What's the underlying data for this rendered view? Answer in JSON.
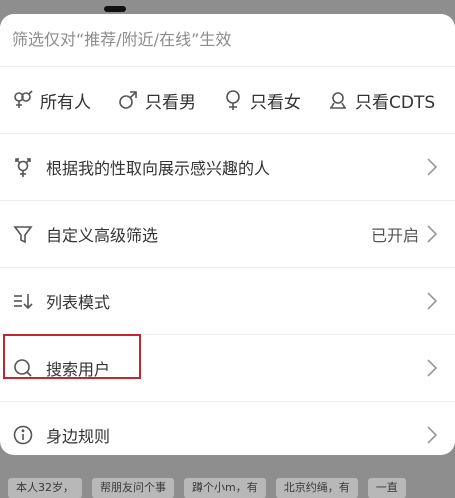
{
  "hint": "筛选仅对“推荐/附近/在线”生效",
  "gender_options": [
    {
      "icon": "all-genders-icon",
      "label": "所有人"
    },
    {
      "icon": "male-icon",
      "label": "只看男"
    },
    {
      "icon": "female-icon",
      "label": "只看女"
    },
    {
      "icon": "cdts-icon",
      "label": "只看CDTS"
    }
  ],
  "rows": [
    {
      "icon": "transgender-icon",
      "label": "根据我的性取向展示感兴趣的人",
      "status": ""
    },
    {
      "icon": "filter-icon",
      "label": "自定义高级筛选",
      "status": "已开启"
    },
    {
      "icon": "list-sort-icon",
      "label": "列表模式",
      "status": ""
    },
    {
      "icon": "search-icon",
      "label": "搜索用户",
      "status": ""
    },
    {
      "icon": "info-icon",
      "label": "身边规则",
      "status": ""
    }
  ],
  "background_chips": [
    "本人32岁，",
    "帮朋友问个事",
    "蹲个小m，有",
    "北京约绳，有",
    "一直"
  ],
  "colors": {
    "highlight": "#c1272d",
    "sheet": "#ffffff",
    "overlay": "#8e8e8e"
  }
}
